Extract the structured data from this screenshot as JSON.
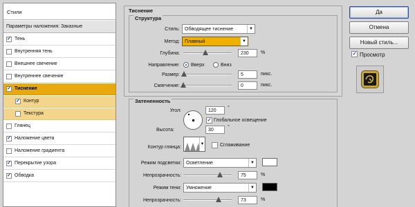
{
  "left_panel": {
    "title": "Стили",
    "subtitle": "Параметры наложения: Заказные",
    "items": [
      {
        "label": "Тень",
        "checked": true,
        "check": "✓"
      },
      {
        "label": "Внутренняя тень",
        "checked": false,
        "check": ""
      },
      {
        "label": "Внешнее свечение",
        "checked": false,
        "check": ""
      },
      {
        "label": "Внутреннее свечение",
        "checked": false,
        "check": ""
      },
      {
        "label": "Тиснение",
        "checked": true,
        "check": "✓",
        "selected": true
      },
      {
        "label": "Контур",
        "checked": true,
        "check": "✓"
      },
      {
        "label": "Текстура",
        "checked": false,
        "check": ""
      },
      {
        "label": "Глянец",
        "checked": false,
        "check": ""
      },
      {
        "label": "Наложение цвета",
        "checked": true,
        "check": "✓"
      },
      {
        "label": "Наложение градиента",
        "checked": false,
        "check": ""
      },
      {
        "label": "Перекрытие узора",
        "checked": true,
        "check": "✓"
      },
      {
        "label": "Обводка",
        "checked": true,
        "check": "✓"
      }
    ]
  },
  "bevel": {
    "title": "Тиснение",
    "structure_title": "Структура",
    "style_label": "Стиль:",
    "style_value": "Обводящее тиснение",
    "method_label": "Метод:",
    "method_value": "Плавный",
    "depth_label": "Глубина:",
    "depth_value": "230",
    "depth_unit": "%",
    "depth_level_pct": 45,
    "direction_label": "Направление:",
    "direction_up": "Вверх",
    "direction_down": "Вниз",
    "direction_selected": "up",
    "size_label": "Размер:",
    "size_value": "5",
    "size_unit": "пикс.",
    "size_level_pct": 2,
    "soften_label": "Смягчение:",
    "soften_value": "0",
    "soften_unit": "пикс.",
    "soften_level_pct": 0
  },
  "shading": {
    "title": "Затененность",
    "angle_label": "Угол:",
    "angle_value": "120",
    "angle_unit": "°",
    "global_light_label": "Глобальное освещение",
    "global_light_checked": true,
    "global_light_check": "✓",
    "altitude_label": "Высота:",
    "altitude_value": "30",
    "altitude_unit": "°",
    "gloss_contour_label": "Контур глянца:",
    "antialias_label": "Сглаживание",
    "antialias_checked": false,
    "highlight_mode_label": "Режим подсветки:",
    "highlight_mode_value": "Осветление",
    "highlight_color": "#ffffff",
    "highlight_opacity_label": "Непрозрачность:",
    "highlight_opacity_value": "75",
    "highlight_opacity_unit": "%",
    "shadow_mode_label": "Режим тени:",
    "shadow_mode_value": "Умножение",
    "shadow_color": "#000000",
    "shadow_opacity_label": "Непрозрачность:",
    "shadow_opacity_value": "73",
    "shadow_opacity_unit": "%"
  },
  "right_panel": {
    "ok_label": "Да",
    "cancel_label": "Отмена",
    "new_style_label": "Новый стиль...",
    "preview_label": "Просмотр",
    "preview_checked": true,
    "preview_check": "✓"
  },
  "colors": {
    "selection": "#e8a810",
    "selection_child": "#f3d58b",
    "method_highlight": "#f0b000"
  }
}
